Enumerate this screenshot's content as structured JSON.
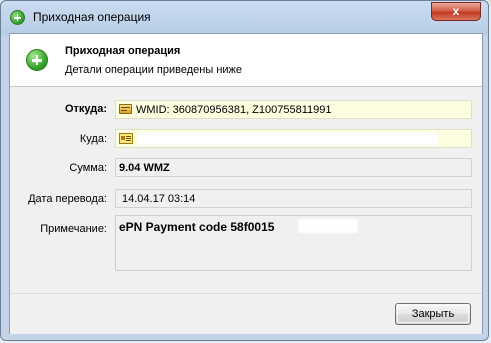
{
  "window": {
    "title": "Приходная операция",
    "close_symbol": "x"
  },
  "header": {
    "title": "Приходная операция",
    "subtitle": "Детали операции приведены ниже"
  },
  "fields": {
    "from": {
      "label": "Откуда:",
      "value": "WMID: 360870956381, Z100755811991",
      "icon": "purse-icon"
    },
    "to": {
      "label": "Куда:",
      "value": "",
      "icon": "certificate-icon"
    },
    "amount": {
      "label": "Сумма:",
      "value": "9.04 WMZ"
    },
    "date": {
      "label": "Дата перевода:",
      "value": "14.04.17 03:14"
    },
    "note": {
      "label": "Примечание:",
      "value": "ePN Payment code 58f0015"
    }
  },
  "footer": {
    "close_button": "Закрыть"
  }
}
